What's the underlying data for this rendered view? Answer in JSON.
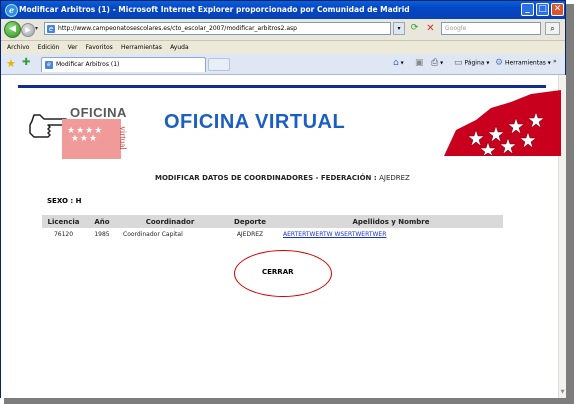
{
  "window": {
    "title": "Modificar Arbitros (1) - Microsoft Internet Explorer proporcionado por Comunidad de Madrid"
  },
  "address_bar": {
    "url": "http://www.campeonatosescolares.es/cto_escolar_2007/modificar_arbitros2.asp",
    "search_placeholder": "Google"
  },
  "menu": {
    "items": [
      "Archivo",
      "Edición",
      "Ver",
      "Favoritos",
      "Herramientas",
      "Ayuda"
    ]
  },
  "tab": {
    "label": "Modificar Arbitros (1)"
  },
  "toolbar": {
    "page_label": "Página",
    "tools_label": "Herramientas"
  },
  "header": {
    "logo_text": "OFICINA",
    "logo_vertical": "virtual",
    "title": "OFICINA VIRTUAL"
  },
  "form": {
    "subtitle": "MODIFICAR DATOS DE COORDINADORES - FEDERACIÓN :",
    "federation": "AJEDREZ",
    "sexo": "SEXO : H"
  },
  "table": {
    "headers": [
      "Licencia",
      "Año",
      "Coordinador",
      "Deporte",
      "Apellidos y Nombre"
    ],
    "rows": [
      [
        "76120",
        "1985",
        "Coordinador Capital",
        "AJEDREZ",
        "AERTERTWERTW WSERTWERTWER"
      ]
    ]
  },
  "actions": {
    "close_label": "CERRAR"
  },
  "colors": {
    "title_blue": "#1c5fc4",
    "annotation_red": "#d60000",
    "header_row": "#d9d9d9",
    "link_blue": "#1a33cc",
    "flag_red": "#c8001e"
  }
}
